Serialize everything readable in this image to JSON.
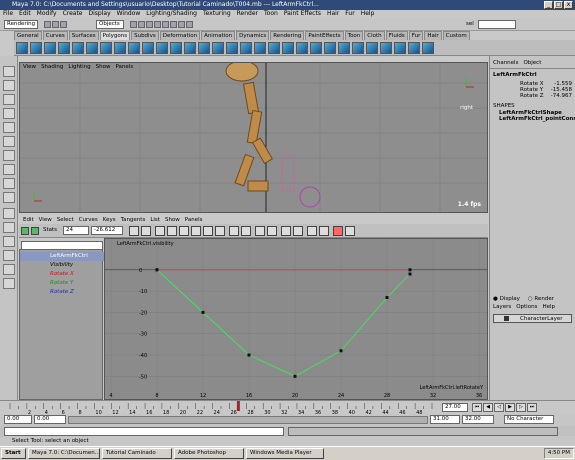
{
  "window": {
    "title": "Maya 7.0: C:\\Documents and Settings\\usuario\\Desktop\\Tutorial Caminado\\T004.mb   ---   LeftArmFkCtrl...",
    "controls": [
      "_",
      "□",
      "x"
    ]
  },
  "menubar": {
    "items": [
      "File",
      "Edit",
      "Modify",
      "Create",
      "Display",
      "Window",
      "Lighting/Shading",
      "Texturing",
      "Render",
      "Toon",
      "Paint Effects",
      "Hair",
      "Fur",
      "Help"
    ]
  },
  "statusline": {
    "mode": "Rendering",
    "objects_label": "Objects",
    "sel_label": "sel"
  },
  "shelf": {
    "tabs": [
      "General",
      "Curves",
      "Surfaces",
      "Polygons",
      "Subdivs",
      "Deformation",
      "Animation",
      "Dynamics",
      "Rendering",
      "PaintEffects",
      "Toon",
      "Cloth",
      "Fluids",
      "Fur",
      "Hair",
      "Custom"
    ],
    "active": "Polygons"
  },
  "viewport": {
    "menu": [
      "View",
      "Shading",
      "Lighting",
      "Show",
      "Panels"
    ],
    "fps": "1.4 fps",
    "view_label": "right"
  },
  "graph_editor": {
    "menu": [
      "Edit",
      "View",
      "Select",
      "Curves",
      "Keys",
      "Tangents",
      "List",
      "Show",
      "Panels"
    ],
    "stats_label": "Stats",
    "stats_value1": "24",
    "stats_value2": "-26.612",
    "graph_title": "LeftArmFkCtrl.visibility",
    "curve_label": "LeftArmFkCtrl.leftRotateY",
    "outliner": [
      "LeftArmFkCtrl",
      "Visibility",
      "Rotate X",
      "Rotate Y",
      "Rotate Z"
    ]
  },
  "chart_data": {
    "type": "line",
    "x_ticks": [
      4,
      8,
      12,
      16,
      20,
      24,
      28,
      32,
      36
    ],
    "y_ticks": [
      0,
      -10,
      -20,
      -30,
      -40,
      -50
    ],
    "xlim": [
      4,
      36
    ],
    "ylim": [
      -55,
      6
    ],
    "series": [
      {
        "name": "Visibility",
        "color": "#e04060",
        "x": [
          8,
          30
        ],
        "y": [
          0,
          0
        ]
      },
      {
        "name": "Rotate Y",
        "color": "#40e060",
        "x": [
          8,
          12,
          16,
          20,
          24,
          28,
          30
        ],
        "y": [
          0,
          -20,
          -40,
          -50,
          -38,
          -13,
          -2
        ]
      }
    ]
  },
  "channelbox": {
    "menu": [
      "Channels",
      "Object"
    ],
    "object": "LeftArmFkCtrl",
    "attrs": [
      {
        "label": "Rotate X",
        "value": "-1.559"
      },
      {
        "label": "Rotate Y",
        "value": "-15.458"
      },
      {
        "label": "Rotate Z",
        "value": "-74.967"
      }
    ],
    "shapes_label": "SHAPES",
    "shapes": [
      "LeftArmFkCtrlShape",
      "LeftArmFkCtrl_pointConstrai"
    ]
  },
  "layers": {
    "display": "Display",
    "render": "Render",
    "menu": [
      "Layers",
      "Options",
      "Help"
    ],
    "layer_name": "CharacterLayer"
  },
  "timeline": {
    "ticks": [
      2,
      4,
      6,
      8,
      10,
      12,
      14,
      16,
      18,
      20,
      22,
      24,
      26,
      28,
      30,
      32,
      34,
      36,
      38,
      40,
      42,
      44,
      46,
      48
    ],
    "current": "27.00"
  },
  "range": {
    "start": "0.00",
    "start2": "0.00",
    "end": "31.00",
    "end2": "32.00",
    "character": "No Character Set"
  },
  "helpline": {
    "text": "Select Tool: select an object"
  },
  "taskbar": {
    "start": "Start",
    "apps": [
      "Maya 7.0: C:\\Documen...",
      "Tutorial Caminado",
      "Adobe Photoshop",
      "Windows Media Player"
    ],
    "clock": "4:50 PM"
  }
}
